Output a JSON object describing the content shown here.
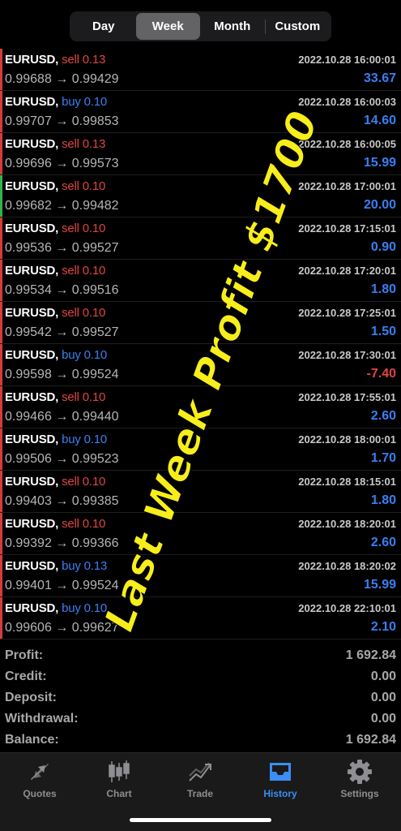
{
  "period_tabs": [
    {
      "label": "Day",
      "active": false
    },
    {
      "label": "Week",
      "active": true
    },
    {
      "label": "Month",
      "active": false
    },
    {
      "label": "Custom",
      "active": false
    }
  ],
  "deals": [
    {
      "symbol": "EURUSD,",
      "type": "sell",
      "volume": "0.13",
      "open": "0.99688",
      "close": "0.99429",
      "time": "2022.10.28 16:00:01",
      "profit": "33.67"
    },
    {
      "symbol": "EURUSD,",
      "type": "buy",
      "volume": "0.10",
      "open": "0.99707",
      "close": "0.99853",
      "time": "2022.10.28 16:00:03",
      "profit": "14.60"
    },
    {
      "symbol": "EURUSD,",
      "type": "sell",
      "volume": "0.13",
      "open": "0.99696",
      "close": "0.99573",
      "time": "2022.10.28 16:00:05",
      "profit": "15.99"
    },
    {
      "symbol": "EURUSD,",
      "type": "sell",
      "volume": "0.10",
      "open": "0.99682",
      "close": "0.99482",
      "time": "2022.10.28 17:00:01",
      "profit": "20.00"
    },
    {
      "symbol": "EURUSD,",
      "type": "sell",
      "volume": "0.10",
      "open": "0.99536",
      "close": "0.99527",
      "time": "2022.10.28 17:15:01",
      "profit": "0.90"
    },
    {
      "symbol": "EURUSD,",
      "type": "sell",
      "volume": "0.10",
      "open": "0.99534",
      "close": "0.99516",
      "time": "2022.10.28 17:20:01",
      "profit": "1.80"
    },
    {
      "symbol": "EURUSD,",
      "type": "sell",
      "volume": "0.10",
      "open": "0.99542",
      "close": "0.99527",
      "time": "2022.10.28 17:25:01",
      "profit": "1.50"
    },
    {
      "symbol": "EURUSD,",
      "type": "buy",
      "volume": "0.10",
      "open": "0.99598",
      "close": "0.99524",
      "time": "2022.10.28 17:30:01",
      "profit": "-7.40"
    },
    {
      "symbol": "EURUSD,",
      "type": "sell",
      "volume": "0.10",
      "open": "0.99466",
      "close": "0.99440",
      "time": "2022.10.28 17:55:01",
      "profit": "2.60"
    },
    {
      "symbol": "EURUSD,",
      "type": "buy",
      "volume": "0.10",
      "open": "0.99506",
      "close": "0.99523",
      "time": "2022.10.28 18:00:01",
      "profit": "1.70"
    },
    {
      "symbol": "EURUSD,",
      "type": "sell",
      "volume": "0.10",
      "open": "0.99403",
      "close": "0.99385",
      "time": "2022.10.28 18:15:01",
      "profit": "1.80"
    },
    {
      "symbol": "EURUSD,",
      "type": "sell",
      "volume": "0.10",
      "open": "0.99392",
      "close": "0.99366",
      "time": "2022.10.28 18:20:01",
      "profit": "2.60"
    },
    {
      "symbol": "EURUSD,",
      "type": "buy",
      "volume": "0.13",
      "open": "0.99401",
      "close": "0.99524",
      "time": "2022.10.28 18:20:02",
      "profit": "15.99"
    },
    {
      "symbol": "EURUSD,",
      "type": "buy",
      "volume": "0.10",
      "open": "0.99606",
      "close": "0.99627",
      "time": "2022.10.28 22:10:01",
      "profit": "2.10"
    }
  ],
  "summary": [
    {
      "label": "Profit:",
      "value": "1 692.84"
    },
    {
      "label": "Credit:",
      "value": "0.00"
    },
    {
      "label": "Deposit:",
      "value": "0.00"
    },
    {
      "label": "Withdrawal:",
      "value": "0.00"
    },
    {
      "label": "Balance:",
      "value": "1 692.84"
    }
  ],
  "overlay_text": "Last Week Profit $1700",
  "tabbar": [
    {
      "label": "Quotes",
      "icon": "quotes-arrows-icon",
      "active": false
    },
    {
      "label": "Chart",
      "icon": "candlestick-chart-icon",
      "active": false
    },
    {
      "label": "Trade",
      "icon": "trade-line-icon",
      "active": false
    },
    {
      "label": "History",
      "icon": "history-inbox-icon",
      "active": true
    },
    {
      "label": "Settings",
      "icon": "gear-icon",
      "active": false
    }
  ],
  "colors": {
    "sell": "#e04444",
    "buy": "#3a7ff0",
    "profit_positive": "#3a7ff0",
    "profit_negative": "#e04444",
    "active_tab": "#3a8ef5",
    "overlay": "#f7ee1b"
  }
}
